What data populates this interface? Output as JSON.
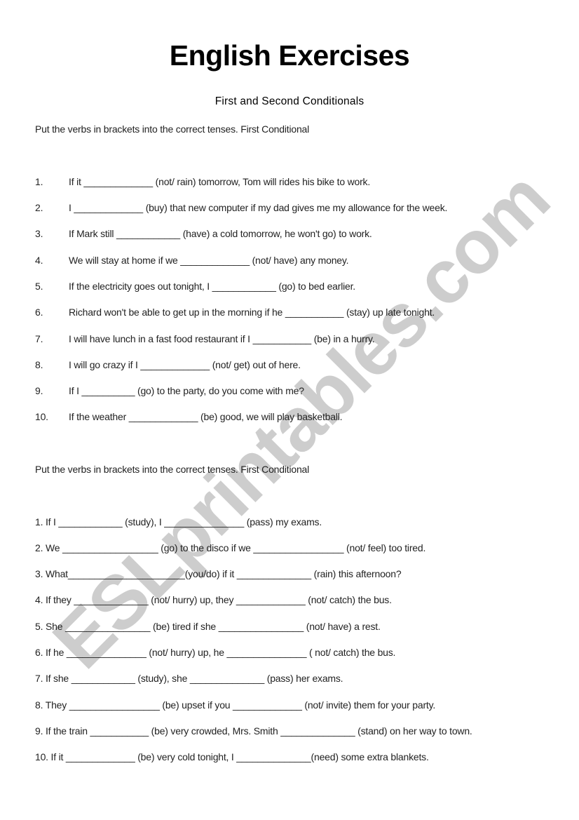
{
  "document": {
    "title": "English Exercises",
    "subtitle": "First and Second Conditionals",
    "watermark": "ESLprintables.com"
  },
  "section1": {
    "instruction": "Put the verbs in brackets into the correct tenses. First Conditional",
    "items": [
      {
        "number": "1.",
        "text": "If it _____________ (not/ rain) tomorrow, Tom will rides his bike to work."
      },
      {
        "number": "2.",
        "text": "I _____________ (buy) that new computer if my dad gives me my allowance for the week."
      },
      {
        "number": "3.",
        "text": "If Mark still ____________ (have) a cold tomorrow, he won't go) to work."
      },
      {
        "number": "4.",
        "text": "We will stay at home if we _____________ (not/ have) any money."
      },
      {
        "number": "5.",
        "text": "If the electricity goes out tonight, I ____________ (go) to bed earlier."
      },
      {
        "number": "6.",
        "text": "Richard won't be able to get up in the morning if he ___________ (stay) up late tonight."
      },
      {
        "number": "7.",
        "text": "I will have lunch in a fast food restaurant if I ___________ (be) in a hurry."
      },
      {
        "number": "8.",
        "text": "I will go crazy if I _____________ (not/ get) out of here."
      },
      {
        "number": "9.",
        "text": "If I __________ (go) to the party, do you come with me?"
      },
      {
        "number": "10.",
        "text": "If the weather _____________ (be) good, we will play basketball."
      }
    ]
  },
  "section2": {
    "instruction": "Put the verbs in brackets into the correct tenses. First Conditional",
    "items": [
      {
        "text": "1. If I ____________ (study), I _______________ (pass) my exams."
      },
      {
        "text": "2. We __________________ (go) to the disco if we _________________ (not/ feel) too tired."
      },
      {
        "text": "3. What______________________(you/do) if it ______________ (rain) this afternoon?"
      },
      {
        "text": "4. If they ______________ (not/ hurry) up, they _____________ (not/ catch) the bus."
      },
      {
        "text": "5. She ________________ (be) tired if she  ________________ (not/ have) a rest."
      },
      {
        "text": "6. If he _______________ (not/ hurry) up, he _______________ ( not/ catch) the bus."
      },
      {
        "text": "7. If she ____________ (study), she ______________ (pass) her exams."
      },
      {
        "text": "8. They _________________ (be) upset if you _____________ (not/ invite) them for your party."
      },
      {
        "text": "9. If the train ___________ (be) very crowded, Mrs. Smith ______________ (stand) on her way to town."
      },
      {
        "text": "10. If it _____________ (be) very cold tonight, I ______________(need) some extra blankets."
      }
    ]
  }
}
